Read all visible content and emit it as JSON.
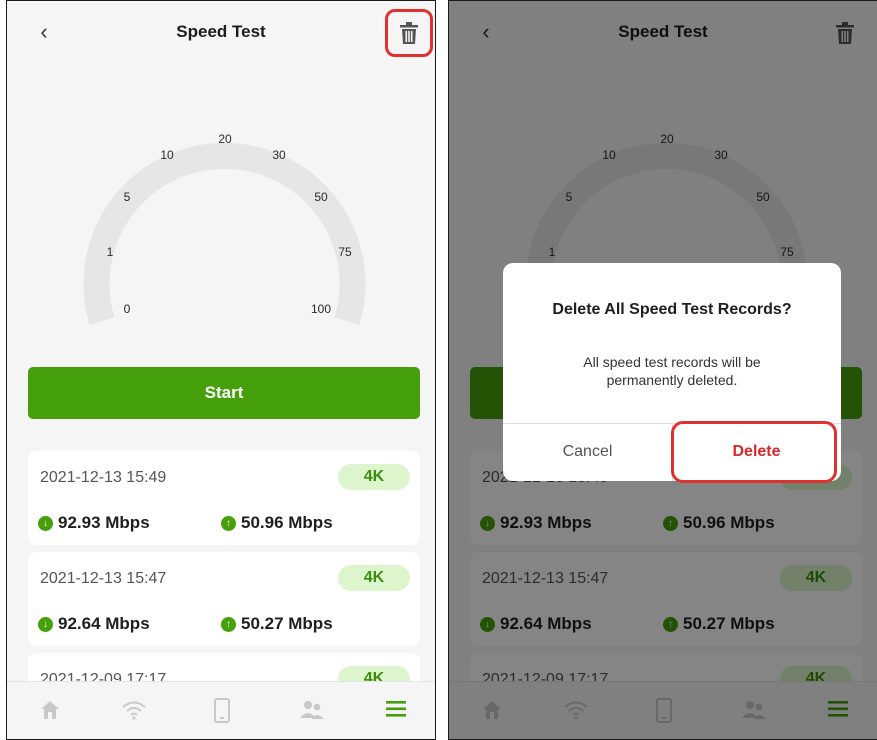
{
  "header": {
    "title": "Speed Test",
    "back_icon": "chevron-left-icon",
    "delete_icon": "trash-icon"
  },
  "gauge": {
    "ticks": [
      "0",
      "1",
      "5",
      "10",
      "20",
      "30",
      "50",
      "75",
      "100"
    ]
  },
  "start_label": "Start",
  "records": [
    {
      "date": "2021-12-13 15:49",
      "badge": "4K",
      "download": "92.93 Mbps",
      "upload": "50.96 Mbps"
    },
    {
      "date": "2021-12-13 15:47",
      "badge": "4K",
      "download": "92.64 Mbps",
      "upload": "50.27 Mbps"
    },
    {
      "date": "2021-12-09 17:17",
      "badge": "4K",
      "download": "",
      "upload": ""
    }
  ],
  "nav": [
    "home-icon",
    "wifi-icon",
    "device-icon",
    "users-icon",
    "menu-icon"
  ],
  "dialog": {
    "title": "Delete All Speed Test Records?",
    "message": "All speed test records will be permanently deleted.",
    "cancel": "Cancel",
    "delete": "Delete"
  },
  "colors": {
    "accent": "#45a00b",
    "badge_bg": "#dcf5cc",
    "danger": "#d8272c",
    "highlight": "#e03131"
  }
}
